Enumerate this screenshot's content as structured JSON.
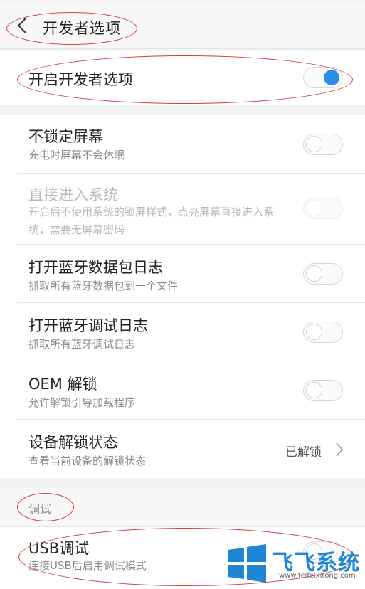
{
  "header": {
    "title": "开发者选项"
  },
  "master_toggle": {
    "label": "开启开发者选项",
    "on": true
  },
  "settings": [
    {
      "title": "不锁定屏幕",
      "subtitle": "充电时屏幕不会休眠",
      "toggle_on": false,
      "enabled": true
    },
    {
      "title": "直接进入系统",
      "subtitle": "开启后不使用系统的锁屏样式，点亮屏幕直接进入系统，需要无屏幕密码",
      "toggle_on": false,
      "enabled": false
    },
    {
      "title": "打开蓝牙数据包日志",
      "subtitle": "抓取所有蓝牙数据包到一个文件",
      "toggle_on": false,
      "enabled": true
    },
    {
      "title": "打开蓝牙调试日志",
      "subtitle": "抓取所有蓝牙调试日志",
      "toggle_on": false,
      "enabled": true
    },
    {
      "title": "OEM 解锁",
      "subtitle": "允许解锁引导加载程序",
      "toggle_on": false,
      "enabled": true
    }
  ],
  "unlock_status": {
    "title": "设备解锁状态",
    "subtitle": "查看当前设备的解锁状态",
    "value": "已解锁"
  },
  "debug_section": {
    "label": "调试",
    "usb_debug": {
      "title": "USB调试",
      "subtitle": "连接USB后启用调试模式",
      "toggle_on": false
    }
  },
  "watermark": {
    "name": "飞飞系统",
    "url": "www.feifeixitong.com"
  },
  "colors": {
    "accent": "#2e8fe8",
    "annotation": "#d9383c",
    "watermark": "#1f86d6"
  }
}
